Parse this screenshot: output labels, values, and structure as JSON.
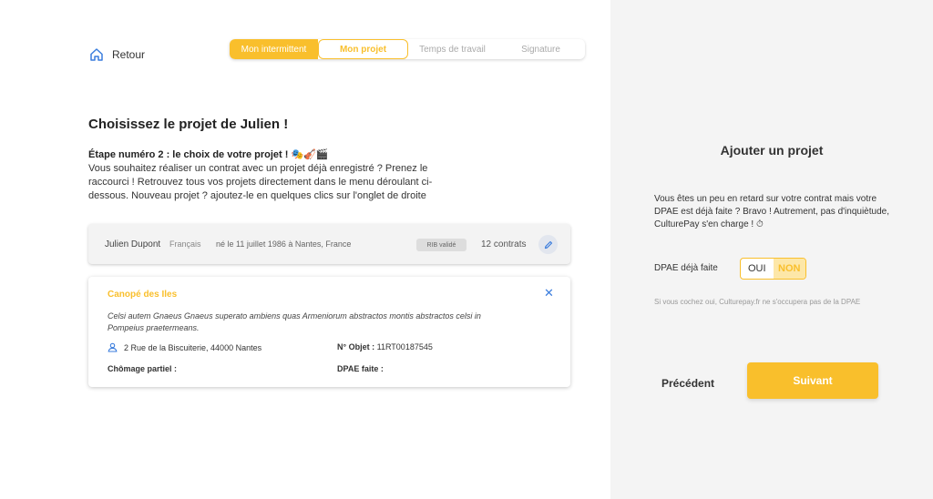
{
  "nav": {
    "back_label": "Retour"
  },
  "stepper": {
    "steps": [
      {
        "label": "Mon intermittent",
        "state": "done"
      },
      {
        "label": "Mon projet",
        "state": "current"
      },
      {
        "label": "Temps de travail",
        "state": "todo"
      },
      {
        "label": "Signature",
        "state": "todo"
      }
    ]
  },
  "main": {
    "title": "Choisissez le projet de Julien !",
    "step_heading": "Étape numéro 2 : le choix de votre projet ! 🎭🎻🎬",
    "step_text": "Vous souhaitez réaliser un contrat avec un projet déjà enregistré ? Prenez le raccourci ! Retrouvez tous vos projets directement dans le menu déroulant ci-dessous. Nouveau projet ? ajoutez-le en quelques clics sur l'onglet de droite"
  },
  "person": {
    "name": "Julien Dupont",
    "nationality": "Français",
    "birth": "né le 11 juillet 1986 à Nantes, France",
    "rib_badge": "RIB validé",
    "contracts": "12 contrats"
  },
  "project": {
    "title": "Canopé des Iles",
    "description": "Celsi autem Gnaeus Gnaeus superato ambiens quas Armeniorum abstractos montis abstractos celsi in Pompeius praetermeans.",
    "address": "2 Rue de la Biscuiterie, 44000 Nantes",
    "objet_label": "N° Objet :",
    "objet_value": "11RT00187545",
    "chomage_label": "Chômage partiel :",
    "dpae_label": "DPAE faite :"
  },
  "sidebar": {
    "title": "Ajouter un projet",
    "text": "Vous êtes un peu en retard sur votre contrat mais votre DPAE est déjà faite ? Bravo ! Autrement, pas d'inquiètude, CulturePay s'en charge ! ⏱",
    "dpae_question": "DPAE déjà faite",
    "toggle_yes": "OUI",
    "toggle_no": "NON",
    "toggle_selected": "NON",
    "note": "Si vous cochez oui, Culturepay.fr ne s'occupera pas de la DPAE",
    "prev_label": "Précédent",
    "next_label": "Suivant"
  },
  "colors": {
    "accent": "#f9bf2c",
    "link": "#3b7ddd",
    "panel_bg": "#f4f4f4"
  }
}
